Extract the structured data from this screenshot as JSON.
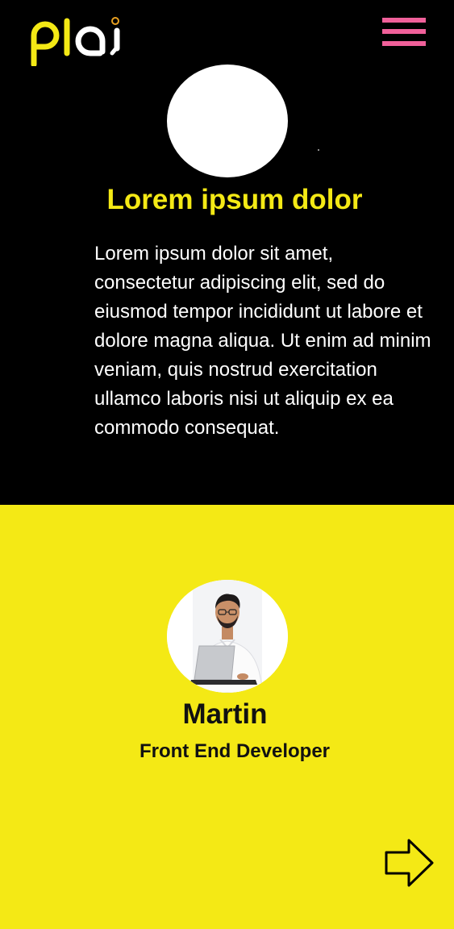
{
  "header": {
    "logo_text": "pla",
    "menu_icon": "hamburger-menu-icon"
  },
  "hero": {
    "title": "Lorem ipsum dolor",
    "body": "Lorem ipsum dolor sit amet, consectetur adipiscing elit, sed do eiusmod tempor incididunt ut labore et dolore magna aliqua. Ut enim ad minim veniam, quis nostrud exercitation ullamco laboris nisi ut aliquip ex ea commodo consequat."
  },
  "profile": {
    "name": "Martin",
    "role": "Front End Developer"
  },
  "next_icon": "arrow-right-icon",
  "colors": {
    "accent_yellow": "#f4e915",
    "menu_pink": "#f0609a",
    "background_dark": "#000000",
    "text_light": "#ffffff",
    "text_dark": "#111111"
  }
}
